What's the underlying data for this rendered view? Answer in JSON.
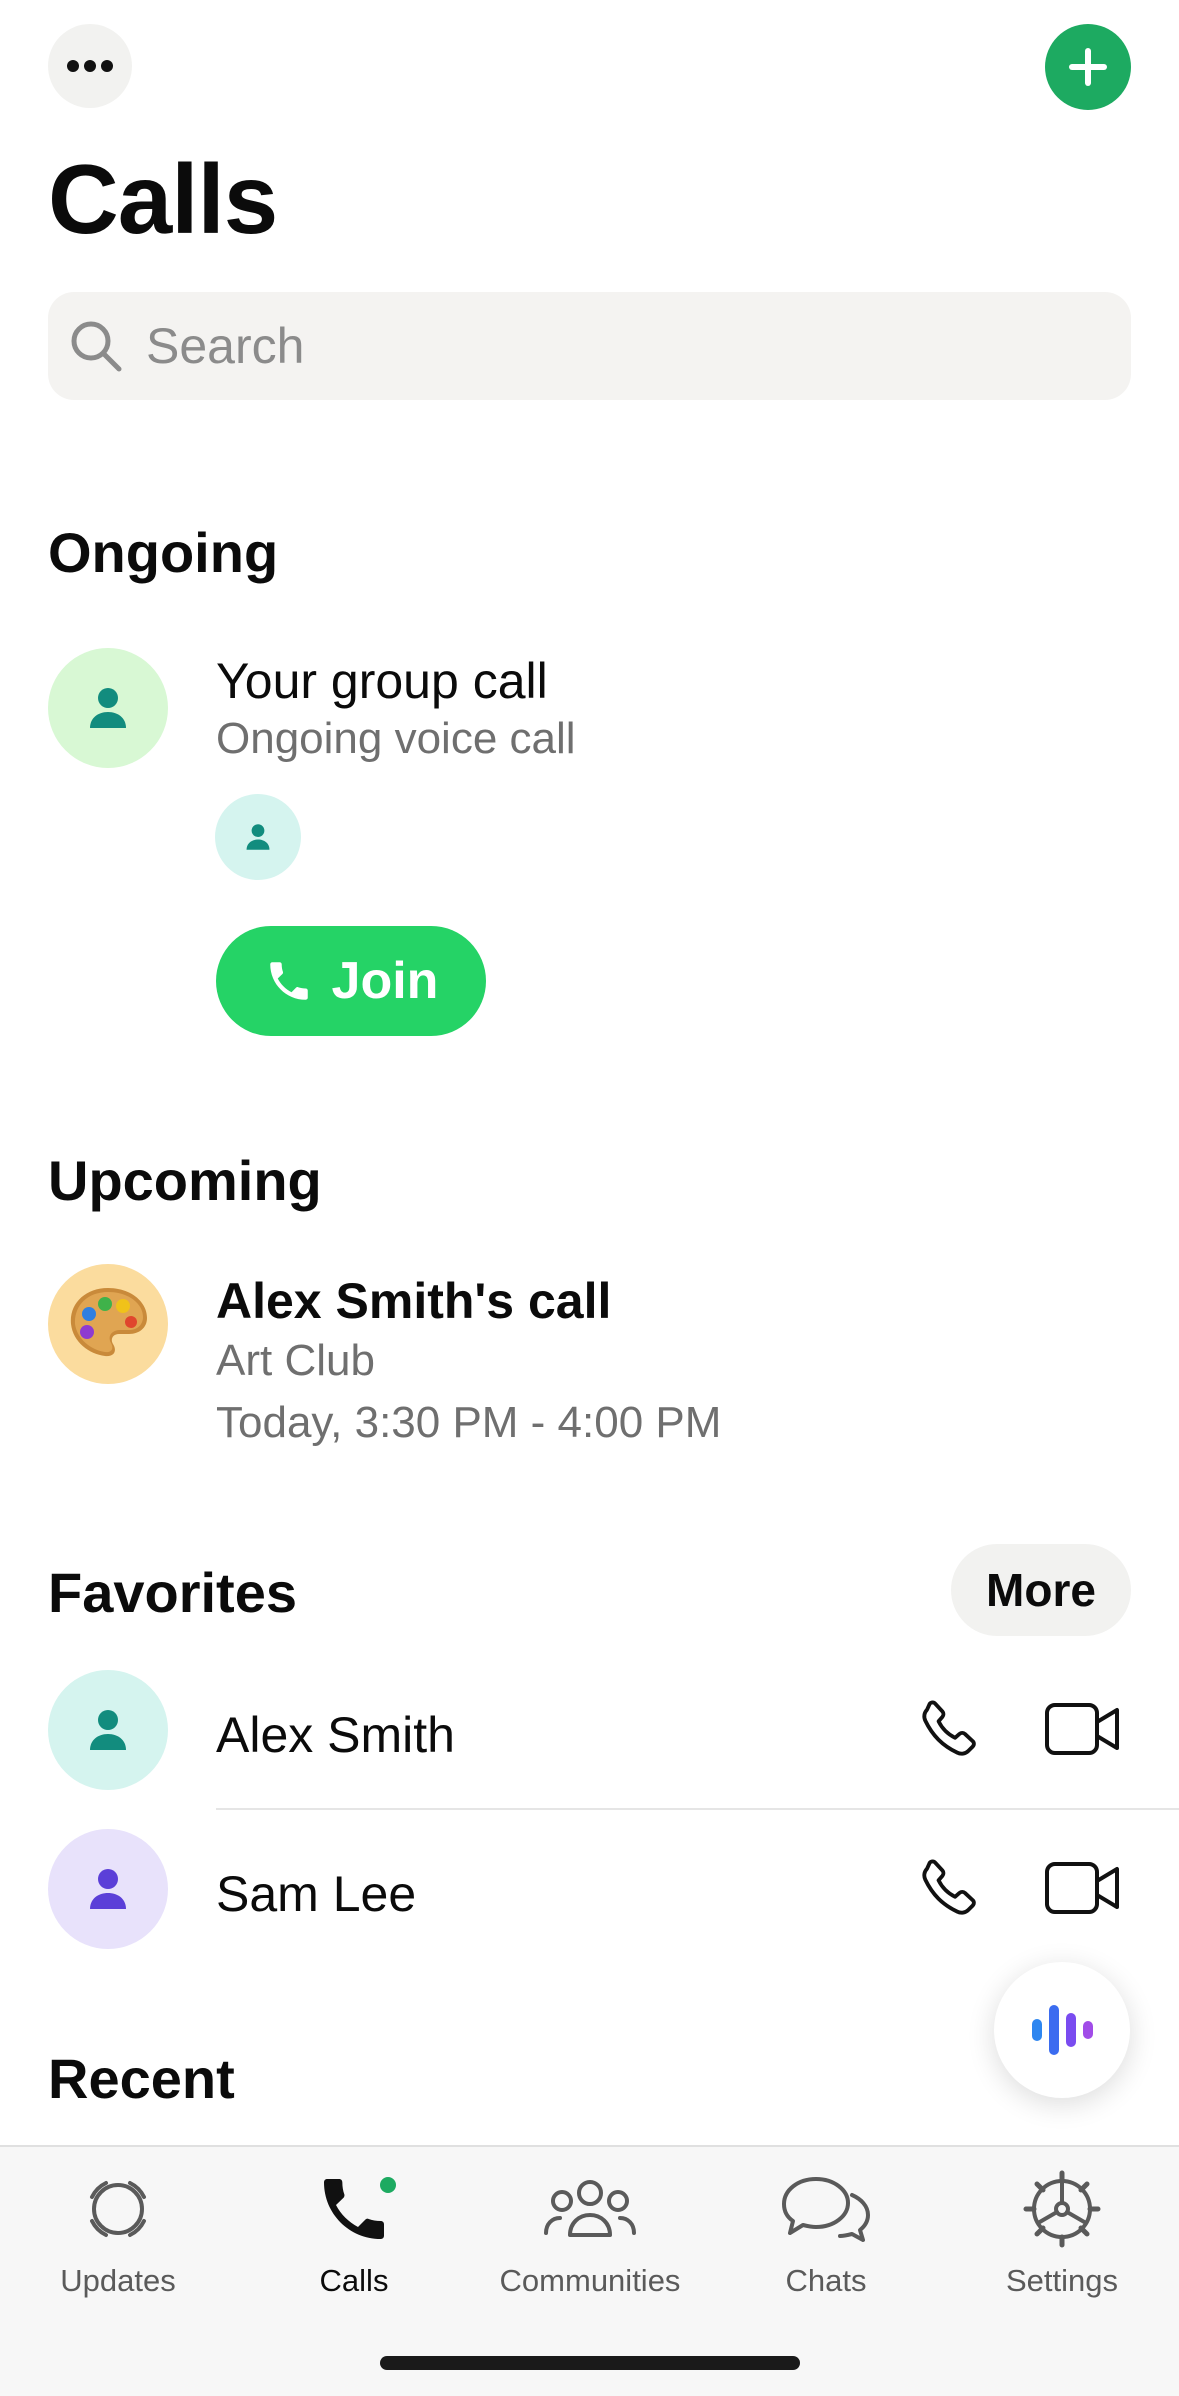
{
  "header": {
    "more_icon": "ellipsis-icon",
    "add_icon": "plus-icon",
    "title": "Calls"
  },
  "search": {
    "placeholder": "Search"
  },
  "ongoing": {
    "section_title": "Ongoing",
    "title": "Your group call",
    "subtitle": "Ongoing voice call",
    "join_label": "Join"
  },
  "upcoming": {
    "section_title": "Upcoming",
    "title": "Alex Smith's call",
    "group": "Art Club",
    "time": "Today, 3:30 PM - 4:00 PM"
  },
  "favorites": {
    "section_title": "Favorites",
    "more_label": "More",
    "items": [
      {
        "name": "Alex Smith"
      },
      {
        "name": "Sam Lee"
      }
    ]
  },
  "recent": {
    "section_title": "Recent"
  },
  "tabs": [
    {
      "label": "Updates"
    },
    {
      "label": "Calls"
    },
    {
      "label": "Communities"
    },
    {
      "label": "Chats"
    },
    {
      "label": "Settings"
    }
  ],
  "colors": {
    "accent_green": "#1daa61",
    "join_green": "#25d366",
    "teal_person": "#128c7e",
    "purple_person": "#5b3fd8"
  }
}
